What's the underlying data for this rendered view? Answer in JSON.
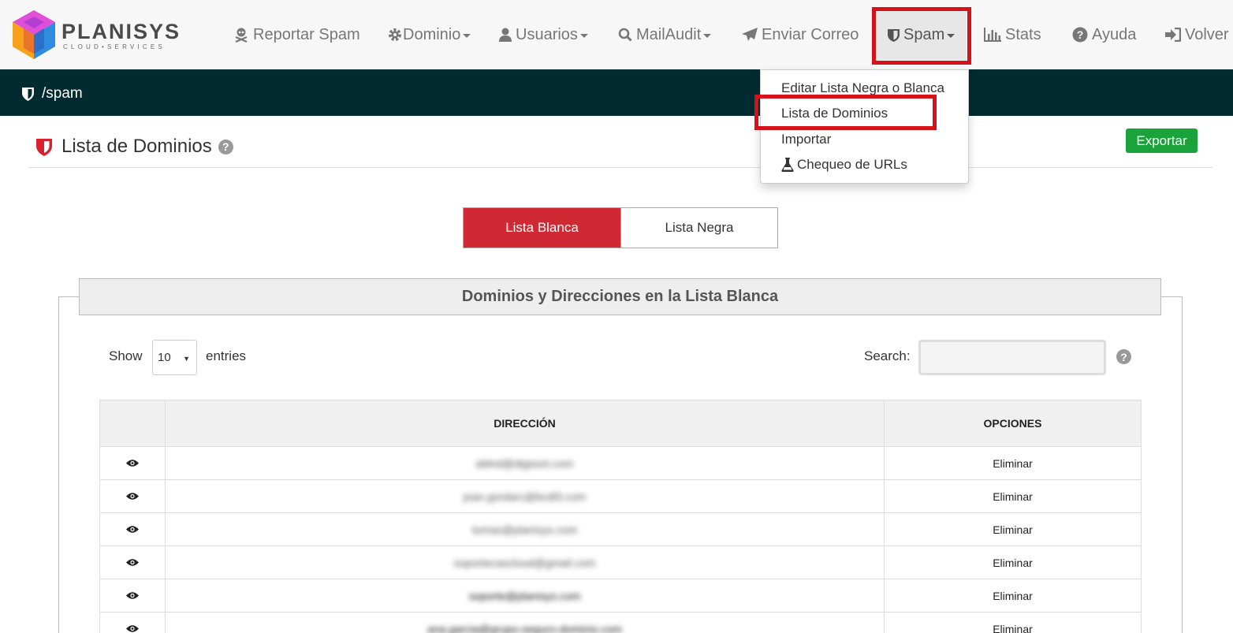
{
  "brand": {
    "name": "PLANISYS",
    "tagline": "CLOUD•SERVICES"
  },
  "nav": {
    "items": [
      {
        "label": "Reportar Spam",
        "icon": "skull-crossbones-icon",
        "dropdown": false
      },
      {
        "label": "Dominio",
        "icon": "gear-icon",
        "dropdown": true
      },
      {
        "label": "Usuarios",
        "icon": "user-icon",
        "dropdown": true
      },
      {
        "label": "MailAudit",
        "icon": "search-icon",
        "dropdown": true
      },
      {
        "label": "Enviar Correo",
        "icon": "paper-plane-icon",
        "dropdown": false
      },
      {
        "label": "Spam",
        "icon": "shield-icon",
        "dropdown": true,
        "open": true
      },
      {
        "label": "Stats",
        "icon": "bar-chart-icon",
        "dropdown": false
      },
      {
        "label": "Ayuda",
        "icon": "question-circle-icon",
        "dropdown": false
      },
      {
        "label": "Volver",
        "icon": "sign-in-icon",
        "dropdown": false
      }
    ]
  },
  "spam_menu": {
    "items": [
      {
        "label": "Editar Lista Negra o Blanca"
      },
      {
        "label": "Lista de Dominios",
        "highlighted": true
      },
      {
        "label": "Importar"
      },
      {
        "label": "Chequeo de URLs",
        "icon": "flask-icon"
      }
    ]
  },
  "breadcrumb": {
    "path": "/spam"
  },
  "page": {
    "title": "Lista de Dominios",
    "export_label": "Exportar"
  },
  "tabs": {
    "active": "Lista Blanca",
    "inactive": "Lista Negra"
  },
  "panel": {
    "title": "Dominios y Direcciones en la Lista Blanca"
  },
  "table_controls": {
    "show_label": "Show",
    "entries_value": "10",
    "entries_label": "entries",
    "search_label": "Search:",
    "search_value": ""
  },
  "table": {
    "columns": [
      "",
      "DIRECCIÓN",
      "OPCIONES"
    ],
    "rows": [
      {
        "address": "ablnd@digisort.com",
        "option": "Eliminar"
      },
      {
        "address": "joan.gordarc@bcdl3.com",
        "option": "Eliminar"
      },
      {
        "address": "tomas@planisys.com",
        "option": "Eliminar"
      },
      {
        "address": "soportecascloud@gmail.com",
        "option": "Eliminar"
      },
      {
        "address": "soporte@planisys.com",
        "option": "Eliminar"
      },
      {
        "address": "ana.garcia@grupo-seguro-dominio.com",
        "option": "Eliminar"
      }
    ]
  },
  "colors": {
    "navbar_bg": "#f7f7f7",
    "breadcrumb_bg": "#012b31",
    "active_tab": "#cf2a34",
    "export_btn": "#1aa33a",
    "highlight_box": "#d5111a"
  }
}
